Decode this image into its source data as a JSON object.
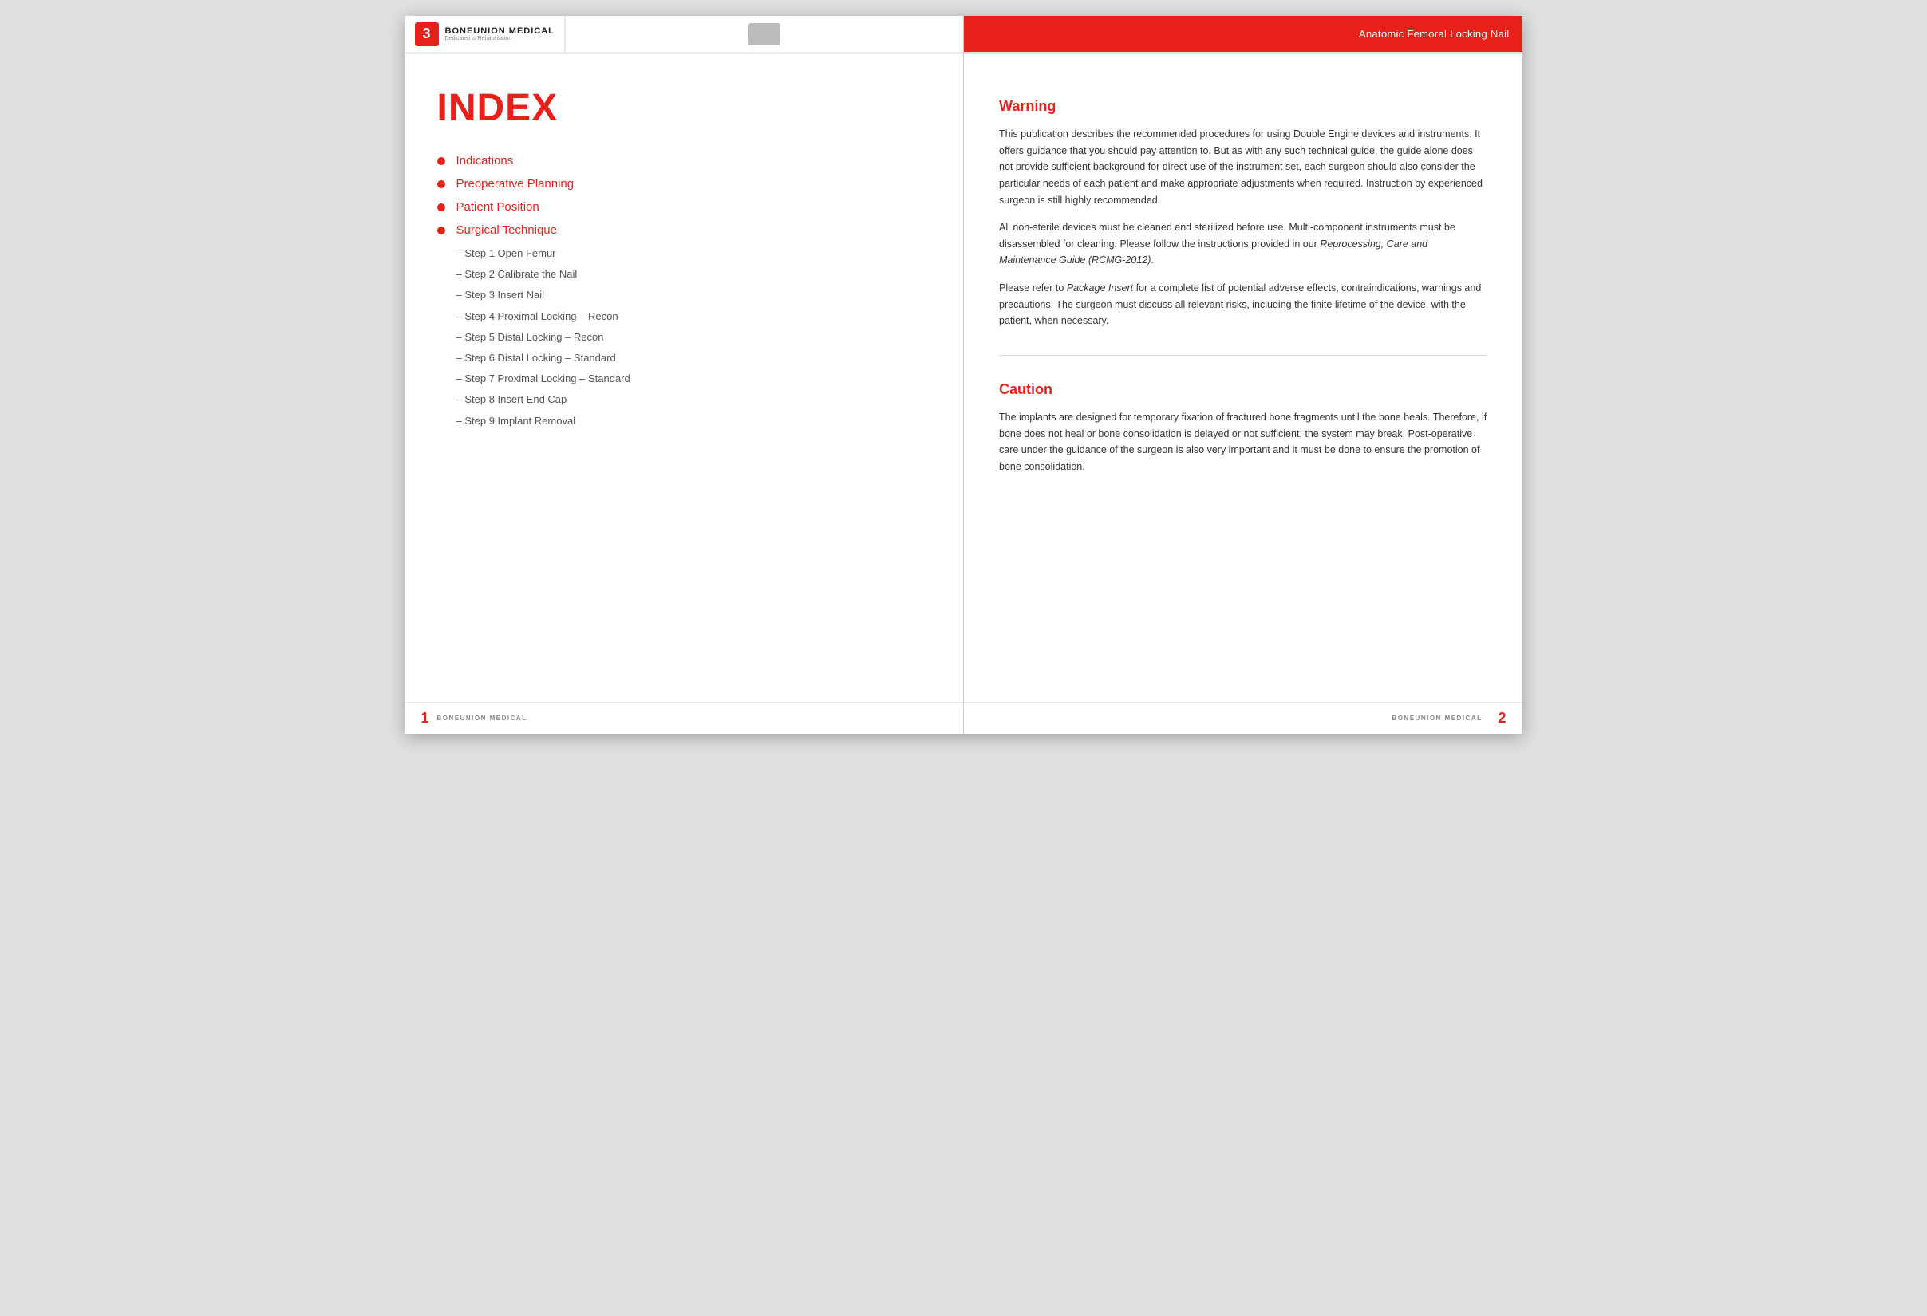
{
  "brand": {
    "logo_letter": "3",
    "name": "BONEUNION MEDICAL",
    "tagline": "Dedicated to Rehabilitation",
    "product_title": "Anatomic Femoral Locking Nail"
  },
  "left_page": {
    "index_title": "INDEX",
    "toc_main_items": [
      {
        "label": "Indications"
      },
      {
        "label": "Preoperative Planning"
      },
      {
        "label": "Patient Position"
      },
      {
        "label": "Surgical Technique"
      }
    ],
    "toc_sub_items": [
      "Step 1 Open Femur",
      "Step 2 Calibrate the Nail",
      "Step 3 Insert Nail",
      "Step 4 Proximal Locking – Recon",
      "Step 5 Distal Locking – Recon",
      "Step 6 Distal Locking – Standard",
      "Step 7 Proximal Locking – Standard",
      "Step 8 Insert End Cap",
      "Step 9 Implant Removal"
    ],
    "page_number": "1",
    "footer_brand": "BONEUNION MEDICAL"
  },
  "right_page": {
    "warning_heading": "Warning",
    "warning_paragraphs": [
      "This publication describes the recommended procedures for using Double Engine devices and instruments. It offers guidance that you should pay attention to. But as with any such technical guide, the guide alone does not provide sufficient background for direct use of the instrument set, each surgeon should also consider the particular needs of each patient and make appropriate adjustments when required. Instruction by experienced surgeon is still highly recommended.",
      "All non-sterile devices must be cleaned and sterilized before use. Multi-component instruments must be disassembled for cleaning. Please follow the instructions provided in our Reprocessing, Care and Maintenance Guide (RCMG-2012).",
      "Please refer to Package Insert for a complete list of potential adverse effects, contraindications, warnings and precautions. The surgeon must discuss all relevant risks, including the finite lifetime of the device, with the patient, when necessary."
    ],
    "caution_heading": "Caution",
    "caution_paragraphs": [
      "The implants are designed for temporary fixation of fractured bone fragments until the bone heals. Therefore, if bone does not heal or bone consolidation is delayed or not sufficient, the system may break. Post-operative care under the guidance of the surgeon is also very important and it must be done to ensure the promotion of bone consolidation."
    ],
    "page_number": "2",
    "footer_brand": "BONEUNION MEDICAL"
  }
}
